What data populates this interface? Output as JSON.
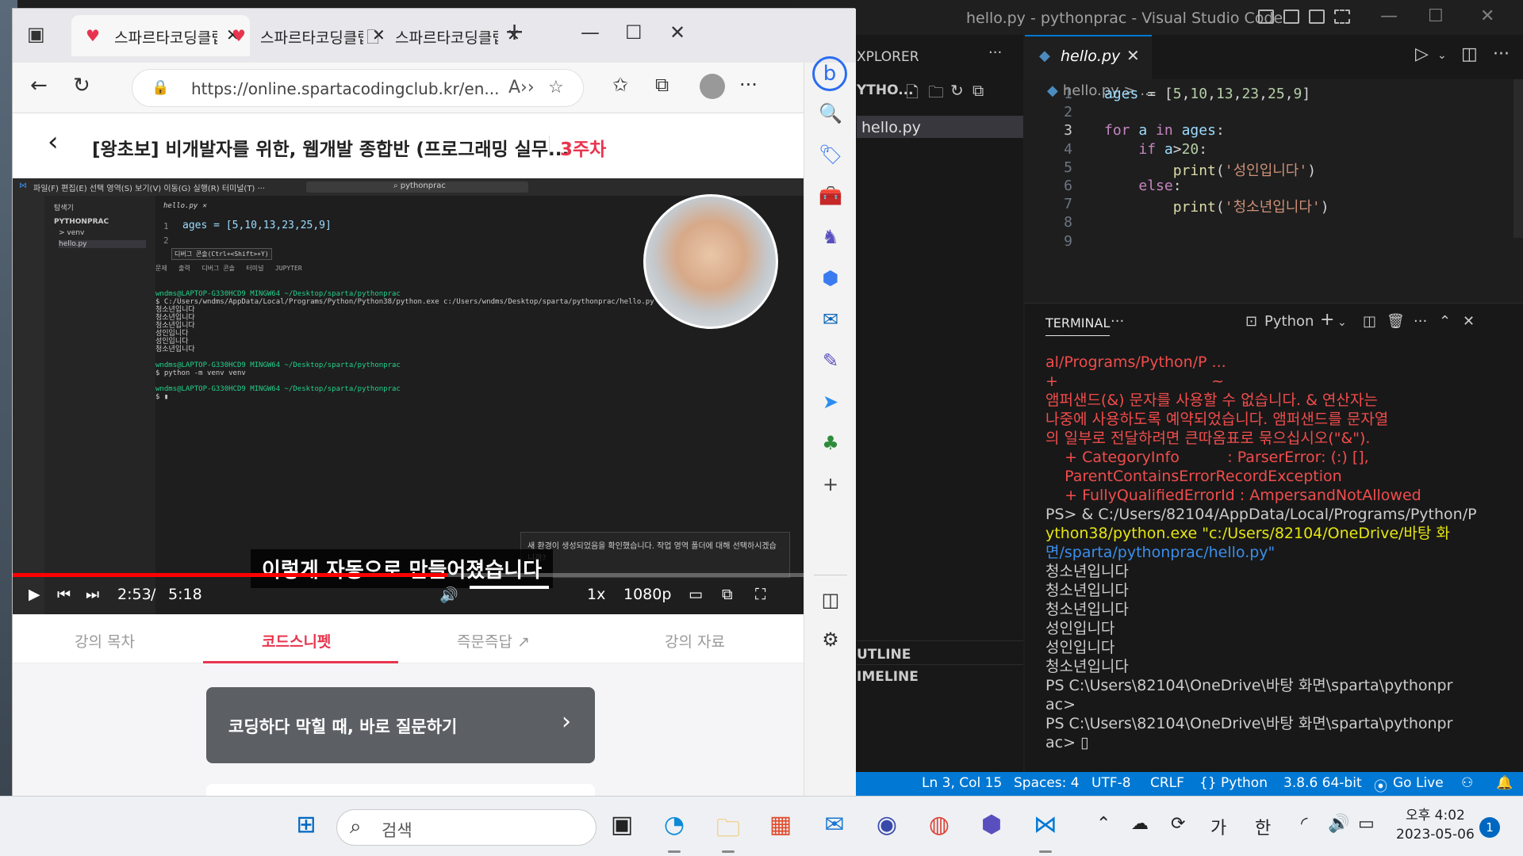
{
  "vscode": {
    "title": "hello.py - pythonprac - Visual Studio Code",
    "explorer_header": "XPLORER",
    "explorer_section": "YTHO...",
    "explorer_file": "hello.py",
    "outline": "UTLINE",
    "timeline": "IMELINE",
    "tab_name": "hello.py",
    "breadcrumb": "hello.py > ...",
    "code": [
      {
        "n": "1",
        "html": "ages = [5,10,13,23,25,9]"
      },
      {
        "n": "2",
        "html": ""
      },
      {
        "n": "3",
        "html": "for a in ages:"
      },
      {
        "n": "4",
        "html": "    if a>20:"
      },
      {
        "n": "5",
        "html": "        print('성인입니다')"
      },
      {
        "n": "6",
        "html": "    else:"
      },
      {
        "n": "7",
        "html": "        print('청소년입니다')"
      },
      {
        "n": "8",
        "html": ""
      },
      {
        "n": "9",
        "html": ""
      }
    ],
    "terminal_label": "TERMINAL",
    "terminal_profile": "Python",
    "terminal_lines": [
      {
        "cls": "err",
        "text": "al/Programs/Python/P ..."
      },
      {
        "cls": "err",
        "text": "+                                ~"
      },
      {
        "cls": "err",
        "text": "앰퍼샌드(&) 문자를 사용할 수 없습니다. & 연산자는"
      },
      {
        "cls": "err",
        "text": "나중에 사용하도록 예약되었습니다. 앰퍼샌드를 문자열"
      },
      {
        "cls": "err",
        "text": "의 일부로 전달하려면 큰따옴표로 묶으십시오(\"&\")."
      },
      {
        "cls": "err",
        "text": "    + CategoryInfo          : ParserError: (:) [],"
      },
      {
        "cls": "err",
        "text": "    ParentContainsErrorRecordException"
      },
      {
        "cls": "err",
        "text": "    + FullyQualifiedErrorId : AmpersandNotAllowed"
      },
      {
        "cls": "tl",
        "text": ""
      },
      {
        "cls": "tl",
        "text": "PS> & C:/Users/82104/AppData/Local/Programs/Python/P"
      },
      {
        "cls": "yel",
        "text": "ython38/python.exe \"c:/Users/82104/OneDrive/바탕 화"
      },
      {
        "cls": "cyan",
        "text": "면/sparta/pythonprac/hello.py\""
      },
      {
        "cls": "tl",
        "text": "청소년입니다"
      },
      {
        "cls": "tl",
        "text": "청소년입니다"
      },
      {
        "cls": "tl",
        "text": "청소년입니다"
      },
      {
        "cls": "tl",
        "text": "성인입니다"
      },
      {
        "cls": "tl",
        "text": "성인입니다"
      },
      {
        "cls": "tl",
        "text": "청소년입니다"
      },
      {
        "cls": "tl",
        "text": "PS C:\\Users\\82104\\OneDrive\\바탕 화면\\sparta\\pythonpr"
      },
      {
        "cls": "tl",
        "text": "ac>"
      },
      {
        "cls": "tl",
        "text": "PS C:\\Users\\82104\\OneDrive\\바탕 화면\\sparta\\pythonpr"
      },
      {
        "cls": "tl",
        "text": "ac> ▯"
      }
    ],
    "status": {
      "position": "Ln 3, Col 15",
      "spaces": "Spaces: 4",
      "encoding": "UTF-8",
      "eol": "CRLF",
      "language": "{} Python",
      "interpreter": "3.8.6 64-bit",
      "golive": "Go Live"
    }
  },
  "edge": {
    "tabs": [
      {
        "title": "스파르타코딩클럽",
        "active": true
      },
      {
        "title": "스파르타코딩클럽",
        "active": false
      },
      {
        "title": "스파르타코딩클럽",
        "active": false
      }
    ],
    "url": "https://online.spartacodingclub.kr/en...",
    "course_title": "[왕초보] 비개발자를 위한, 웹개발 종합반 (프로그래밍 실무...",
    "week": "3주차",
    "video": {
      "subtitle": "이렇게 자동으로 만들어졌습니다",
      "current_time": "2:53",
      "separator": "/",
      "duration": "5:18",
      "speed": "1x",
      "quality": "1080p",
      "progress": 0.55,
      "notification": "새 환경이 생성되었음을 확인했습니다. 작업 영역 폴더에 대해 선택하시겠습니까?",
      "code_line": "ages = [5,10,13,23,25,9]",
      "tooltip": "디버그 콘솔(Ctrl+<Shift>+Y)",
      "panel_tabs": "문제   출력   디버그 콘솔   터미널   JUPYTER",
      "explorer_items": [
        "탐색기",
        "PYTHONPRAC",
        "> venv",
        "hello.py"
      ],
      "term_lines": [
        "wndms@LAPTOP-G330HCD9 MINGW64 ~/Desktop/sparta/pythonprac",
        "$ C:/Users/wndms/AppData/Local/Programs/Python/Python38/python.exe c:/Users/wndms/Desktop/sparta/pythonprac/hello.py",
        "청소년입니다",
        "청소년입니다",
        "청소년입니다",
        "성인입니다",
        "성인입니다",
        "청소년입니다",
        "",
        "wndms@LAPTOP-G330HCD9 MINGW64 ~/Desktop/sparta/pythonprac",
        "$ python -m venv venv",
        "",
        "wndms@LAPTOP-G330HCD9 MINGW64 ~/Desktop/sparta/pythonprac",
        "$ ▮"
      ]
    },
    "lecture_tabs": [
      "강의 목차",
      "코드스니펫",
      "즉문즉답 ↗",
      "강의 자료"
    ],
    "ask_button": "코딩하다 막힐 때, 바로 질문하기"
  },
  "taskbar": {
    "search_placeholder": "검색",
    "ime1": "가",
    "ime2": "한",
    "time": "오후 4:02",
    "date": "2023-05-06",
    "notifications": "1"
  }
}
